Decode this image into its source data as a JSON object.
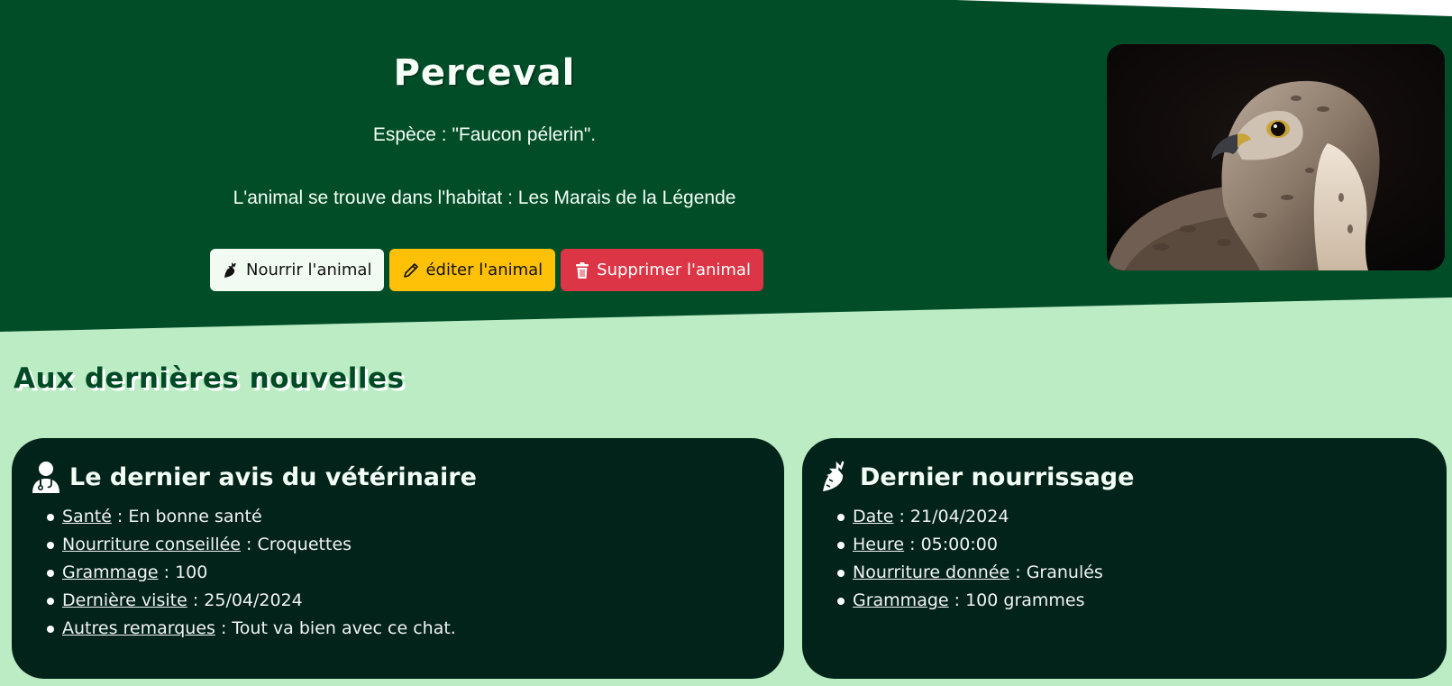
{
  "animal": {
    "name": "Perceval",
    "species_line": "Espèce : \"Faucon pélerin\".",
    "habitat_line": "L'animal se trouve dans l'habitat : Les Marais de la Légende",
    "photo_icon": "falcon-photo"
  },
  "actions": {
    "feed_label": "Nourrir l'animal",
    "edit_label": "éditer l'animal",
    "delete_label": "Supprimer l'animal"
  },
  "news": {
    "heading": "Aux dernières nouvelles"
  },
  "vet_card": {
    "title": "Le dernier avis du vétérinaire",
    "icon": "doctor-icon",
    "items": [
      {
        "key": "Santé",
        "value": " : En bonne santé"
      },
      {
        "key": "Nourriture conseillée",
        "value": " : Croquettes"
      },
      {
        "key": "Grammage",
        "value": " : 100"
      },
      {
        "key": "Dernière visite",
        "value": " : 25/04/2024"
      },
      {
        "key": "Autres remarques",
        "value": " : Tout va bien avec ce chat."
      }
    ]
  },
  "feeding_card": {
    "title": "Dernier nourrissage",
    "icon": "carrot-icon",
    "items": [
      {
        "key": "Date",
        "value": " : 21/04/2024"
      },
      {
        "key": "Heure",
        "value": " : 05:00:00"
      },
      {
        "key": "Nourriture donnée",
        "value": " : Granulés"
      },
      {
        "key": "Grammage",
        "value": " : 100 grammes"
      }
    ]
  },
  "colors": {
    "hero": "#014d28",
    "page": "#bbecc4",
    "card": "#01231a",
    "edit": "#ffc107",
    "delete": "#dc3545"
  }
}
